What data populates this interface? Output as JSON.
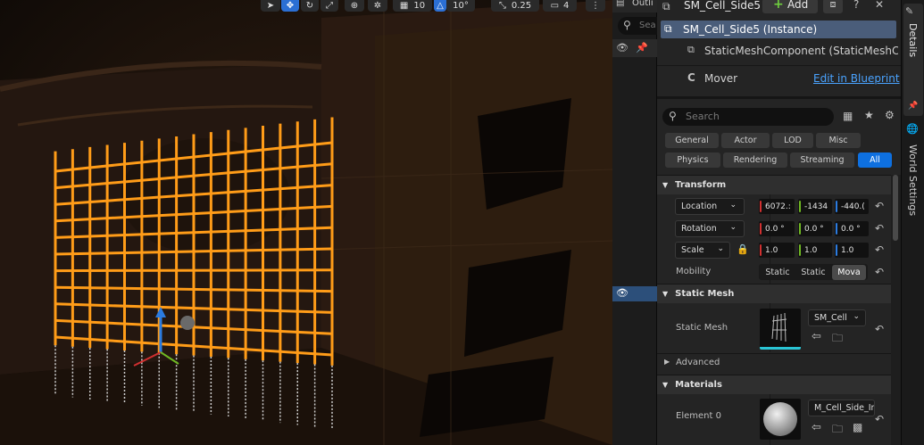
{
  "viewport": {
    "toolbar": {
      "grid_snap": "10",
      "rotation_snap": "10°",
      "scale_snap": "0.25",
      "camera_speed": "4"
    }
  },
  "outliner": {
    "tab_label": "Outli",
    "search_placeholder": "Sea"
  },
  "details": {
    "actor_name": "SM_Cell_Side5",
    "add_label": "Add",
    "components": [
      {
        "label": "SM_Cell_Side5 (Instance)"
      },
      {
        "label": "StaticMeshComponent (StaticMeshCo"
      }
    ],
    "mover_label": "Mover",
    "edit_blueprint": "Edit in Blueprint",
    "search_placeholder": "Search",
    "filters": [
      "General",
      "Actor",
      "LOD",
      "Misc",
      "Physics",
      "Rendering",
      "Streaming",
      "All"
    ],
    "active_filter": "All",
    "transform": {
      "header": "Transform",
      "location_label": "Location",
      "rotation_label": "Rotation",
      "scale_label": "Scale",
      "location": [
        "6072.:",
        "-1434",
        "-440.("
      ],
      "rotation": [
        "0.0 °",
        "0.0 °",
        "0.0 °"
      ],
      "scale": [
        "1.0",
        "1.0",
        "1.0"
      ],
      "mobility_label": "Mobility",
      "mobility": [
        "Static",
        "Static",
        "Mova"
      ]
    },
    "static_mesh": {
      "header": "Static Mesh",
      "label": "Static Mesh",
      "value": "SM_Cell"
    },
    "advanced": "Advanced",
    "materials": {
      "header": "Materials",
      "element_label": "Element 0",
      "value": "M_Cell_Side_In"
    }
  },
  "side_tabs": {
    "details": "Details",
    "world_settings": "World Settings"
  },
  "colors": {
    "accent": "#0e70e0",
    "selection": "#ff9c18",
    "x_axis": "#d23030",
    "y_axis": "#6fb822",
    "z_axis": "#2b7be0"
  }
}
